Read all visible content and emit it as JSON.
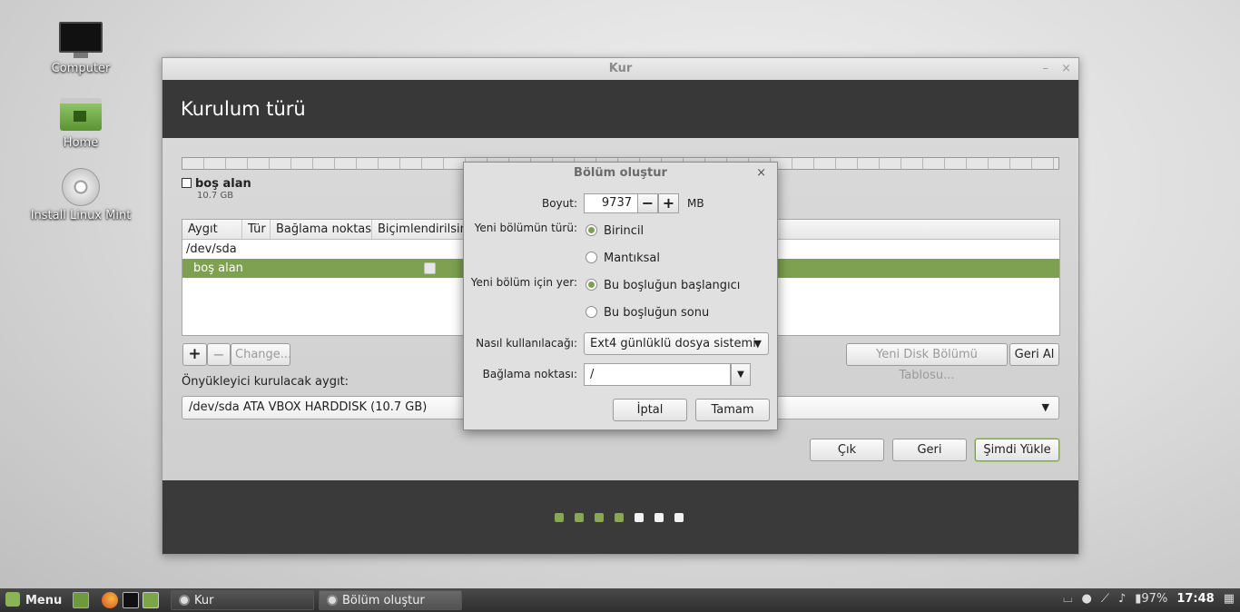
{
  "desktop": {
    "icons": [
      {
        "label": "Computer"
      },
      {
        "label": "Home"
      },
      {
        "label": "Install Linux Mint"
      }
    ]
  },
  "window": {
    "title": "Kur",
    "controls": {
      "minimize": "–",
      "close": "×"
    },
    "header": "Kurulum türü",
    "legend": {
      "name": "boş alan",
      "size": "10.7 GB"
    },
    "table": {
      "columns": [
        "Aygıt",
        "Tür",
        "Bağlama noktası",
        "Biçimlendirilsin"
      ],
      "rows": [
        {
          "device": "/dev/sda"
        },
        {
          "device": "boş alan"
        }
      ]
    },
    "buttons": {
      "add": "+",
      "remove": "−",
      "change": "Change...",
      "new_table": "Yeni Disk Bölümü Tablosu...",
      "revert": "Geri Al",
      "quit": "Çık",
      "back": "Geri",
      "install_now": "Şimdi Yükle"
    },
    "bootloader": {
      "label": "Önyükleyici kurulacak aygıt:",
      "value": "/dev/sda ATA VBOX HARDDISK (10.7 GB)"
    },
    "progress": {
      "total_steps": 7,
      "completed_steps": 4
    }
  },
  "dialog": {
    "title": "Bölüm oluştur",
    "close": "×",
    "size_label": "Boyut:",
    "size_value": "9737",
    "size_unit": "MB",
    "type_label": "Yeni bölümün türü:",
    "type_options": [
      "Birincil",
      "Mantıksal"
    ],
    "type_selected": "Birincil",
    "location_label": "Yeni bölüm için yer:",
    "location_options": [
      "Bu boşluğun başlangıcı",
      "Bu boşluğun sonu"
    ],
    "location_selected": "Bu boşluğun başlangıcı",
    "use_as_label": "Nasıl kullanılacağı:",
    "use_as_value": "Ext4 günlüklü dosya sistemi",
    "mount_label": "Bağlama noktası:",
    "mount_value": "/",
    "cancel": "İptal",
    "ok": "Tamam"
  },
  "taskbar": {
    "menu_label": "Menu",
    "tasks": [
      {
        "label": "Kur"
      },
      {
        "label": "Bölüm oluştur"
      }
    ],
    "battery": "97%",
    "clock": "17:48"
  },
  "colors": {
    "accent": "#7da150",
    "header_bg": "#383838",
    "footer_bg": "#3a3a3a",
    "taskbar_bg": "#3a3a3a"
  }
}
